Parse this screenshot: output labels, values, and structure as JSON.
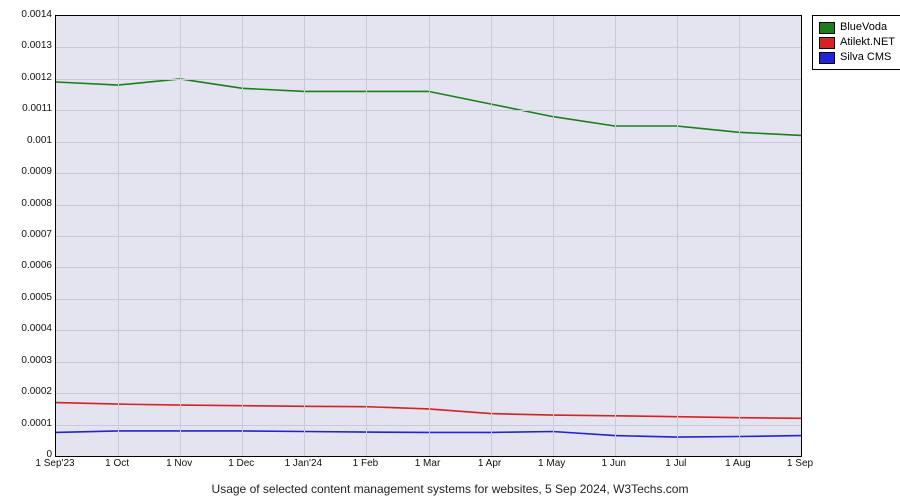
{
  "chart_data": {
    "type": "line",
    "title": "Usage of selected content management systems for websites, 5 Sep 2024, W3Techs.com",
    "xlabel": "",
    "ylabel": "",
    "ylim": [
      0,
      0.0014
    ],
    "x_categories": [
      "1 Sep'23",
      "1 Oct",
      "1 Nov",
      "1 Dec",
      "1 Jan'24",
      "1 Feb",
      "1 Mar",
      "1 Apr",
      "1 May",
      "1 Jun",
      "1 Jul",
      "1 Aug",
      "1 Sep"
    ],
    "y_ticks": [
      0,
      0.0001,
      0.0002,
      0.0003,
      0.0004,
      0.0005,
      0.0006,
      0.0007,
      0.0008,
      0.0009,
      0.001,
      0.0011,
      0.0012,
      0.0013,
      0.0014
    ],
    "series": [
      {
        "name": "BlueVoda",
        "color": "#1a7f1a",
        "values": [
          0.00119,
          0.00118,
          0.0012,
          0.00117,
          0.00116,
          0.00116,
          0.00116,
          0.00112,
          0.00108,
          0.00105,
          0.00105,
          0.00103,
          0.00102
        ]
      },
      {
        "name": "Atilekt.NET",
        "color": "#d62222",
        "values": [
          0.00017,
          0.000165,
          0.000162,
          0.00016,
          0.000158,
          0.000157,
          0.00015,
          0.000135,
          0.00013,
          0.000128,
          0.000125,
          0.000122,
          0.00012
        ]
      },
      {
        "name": "Silva CMS",
        "color": "#2222d6",
        "values": [
          7.5e-05,
          8e-05,
          8e-05,
          8e-05,
          7.8e-05,
          7.6e-05,
          7.5e-05,
          7.5e-05,
          7.8e-05,
          6.5e-05,
          6e-05,
          6.2e-05,
          6.5e-05
        ]
      }
    ]
  },
  "y_tick_labels": [
    "0",
    "0.0001",
    "0.0002",
    "0.0003",
    "0.0004",
    "0.0005",
    "0.0006",
    "0.0007",
    "0.0008",
    "0.0009",
    "0.001",
    "0.0011",
    "0.0012",
    "0.0013",
    "0.0014"
  ]
}
